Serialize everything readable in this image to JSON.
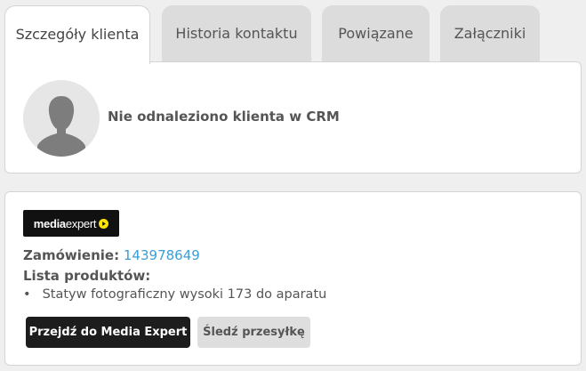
{
  "tabs": [
    {
      "label": "Szczegóły klienta",
      "active": true
    },
    {
      "label": "Historia kontaktu",
      "active": false
    },
    {
      "label": "Powiązane",
      "active": false
    },
    {
      "label": "Załączniki",
      "active": false
    }
  ],
  "customer": {
    "avatar_icon": "user-silhouette-icon",
    "message": "Nie odnaleziono klienta w CRM"
  },
  "order": {
    "logo": {
      "bold": "media",
      "regular": "expert",
      "icon": "play-circle-icon",
      "accent": "#ffe500"
    },
    "order_label": "Zamówienie:",
    "order_number": "143978649",
    "products_label": "Lista produktów:",
    "products": [
      "Statyw fotograficzny wysoki 173 do aparatu"
    ],
    "primary_button": "Przejdź do Media Expert",
    "secondary_button": "Śledź przesyłkę"
  },
  "colors": {
    "link": "#3a9fd6",
    "primary_button": "#1d1d1d",
    "secondary_button": "#dedede",
    "logo_bg": "#111111"
  }
}
